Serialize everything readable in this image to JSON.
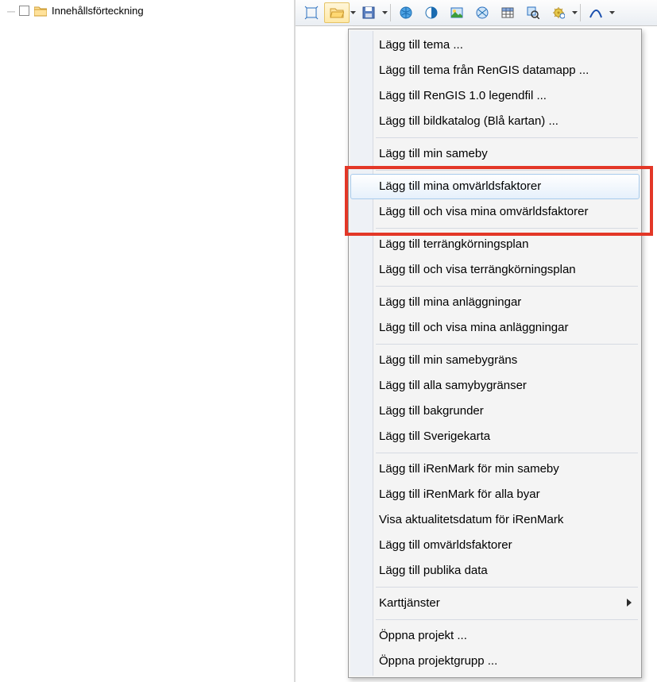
{
  "tree": {
    "root_label": "Innehållsförteckning"
  },
  "menu": {
    "g1": [
      "Lägg till tema ...",
      "Lägg till tema från RenGIS datamapp ...",
      "Lägg till RenGIS 1.0 legendfil ...",
      "Lägg till bildkatalog (Blå kartan) ..."
    ],
    "g2": [
      "Lägg till min sameby"
    ],
    "g3": [
      "Lägg till mina omvärldsfaktorer",
      "Lägg till och visa mina omvärldsfaktorer"
    ],
    "g4": [
      "Lägg till terrängkörningsplan",
      "Lägg till och visa terrängkörningsplan"
    ],
    "g5": [
      "Lägg till mina anläggningar",
      "Lägg till och visa mina anläggningar"
    ],
    "g6": [
      "Lägg till min samebygräns",
      "Lägg till alla samybygränser",
      "Lägg till bakgrunder",
      "Lägg till Sverigekarta"
    ],
    "g7": [
      "Lägg till iRenMark för min sameby",
      "Lägg till iRenMark för alla byar",
      "Visa aktualitetsdatum för iRenMark",
      "Lägg till omvärldsfaktorer",
      "Lägg till publika data"
    ],
    "g8": [
      "Karttjänster"
    ],
    "g9": [
      "Öppna projekt ...",
      "Öppna projektgrupp ..."
    ]
  }
}
